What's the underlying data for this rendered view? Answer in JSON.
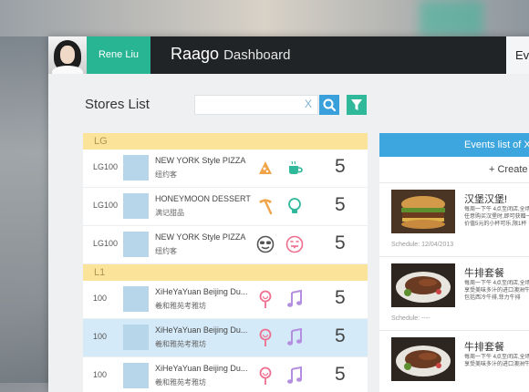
{
  "user": {
    "name": "Rene Liu"
  },
  "brand": {
    "name": "Raago",
    "subtitle": "Dashboard"
  },
  "header_right": "Ev",
  "stores": {
    "title": "Stores List",
    "search": {
      "value": "",
      "placeholder": "",
      "clear": "X"
    },
    "groups": [
      {
        "label": "LG",
        "rows": [
          {
            "code": "LG100",
            "name": "NEW YORK Style PIZZA",
            "cn": "纽约客",
            "icons": [
              "pizza-icon",
              "coffee-cup-icon"
            ],
            "score": "5",
            "selected": false
          },
          {
            "code": "LG100",
            "name": "HONEYMOON DESSERT",
            "cn": "满记甜品",
            "icons": [
              "pickaxe-icon",
              "lightbulb-icon"
            ],
            "score": "5",
            "selected": false
          },
          {
            "code": "LG100",
            "name": "NEW YORK Style PIZZA",
            "cn": "纽约客",
            "icons": [
              "sunglasses-face-icon",
              "tongue-face-icon"
            ],
            "score": "5",
            "selected": false
          }
        ]
      },
      {
        "label": "L1",
        "rows": [
          {
            "code": "100",
            "name": "XiHeYaYuan Beijing Du...",
            "cn": "羲和雅苑考雅坊",
            "icons": [
              "lollipop-icon",
              "music-note-icon"
            ],
            "score": "5",
            "selected": false
          },
          {
            "code": "100",
            "name": "XiHeYaYuan Beijing Du...",
            "cn": "羲和雅苑考雅坊",
            "icons": [
              "lollipop-icon",
              "music-note-icon"
            ],
            "score": "5",
            "selected": true
          },
          {
            "code": "100",
            "name": "XiHeYaYuan Beijing Du...",
            "cn": "羲和雅苑考雅坊",
            "icons": [
              "lollipop-icon",
              "music-note-icon"
            ],
            "score": "5",
            "selected": false
          }
        ]
      }
    ]
  },
  "events": {
    "title": "Events list of X",
    "create": "+ Create",
    "items": [
      {
        "title": "汉堡汉堡!",
        "desc": [
          "每周一下午 4点至闭店,全场",
          "任意购买汉堡时,即可获赠一杯",
          "价值5元的小杯可乐,限1杯"
        ],
        "schedule_label": "Schedule:",
        "schedule": "12/04/2013",
        "photo": "burger"
      },
      {
        "title": "牛排套餐",
        "desc": [
          "每周一下午 4点至闭店,全场",
          "享受美味多汁的进口澳洲牛排",
          "包括西冷牛排,菲力牛排"
        ],
        "schedule_label": "Schedule:",
        "schedule": "----",
        "photo": "steak"
      },
      {
        "title": "牛排套餐",
        "desc": [
          "每周一下午 4点至闭店,全场",
          "享受美味多汁的进口澳洲牛排"
        ],
        "schedule_label": "",
        "schedule": "",
        "photo": "steak"
      }
    ]
  },
  "colors": {
    "header": "#212426",
    "accent_green": "#27b593",
    "accent_blue": "#3ea6de",
    "group_yellow": "#fbe49a",
    "icon_orange": "#f0a347",
    "icon_teal": "#2fb899",
    "icon_pink": "#ee6f8f",
    "icon_purple": "#b48fe0"
  }
}
